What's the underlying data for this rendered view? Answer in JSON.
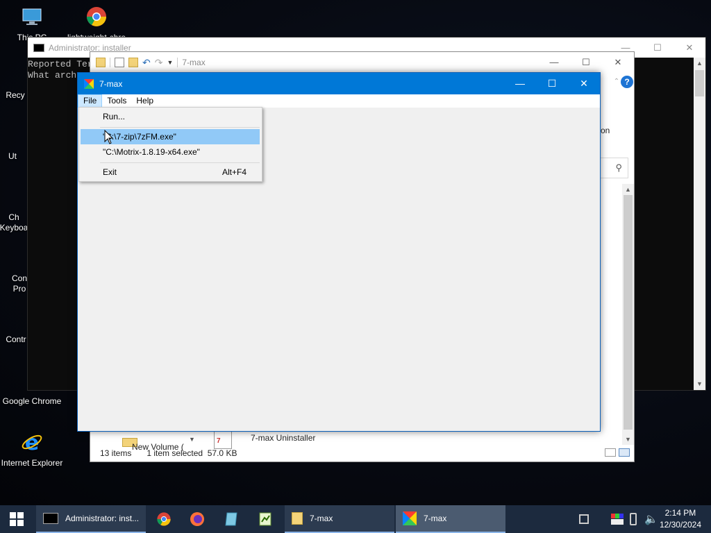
{
  "desktop": {
    "icons": [
      {
        "label": "This PC",
        "icon": "this-pc-icon"
      },
      {
        "label": "lightweight-chro",
        "icon": "chrome-icon"
      },
      {
        "label": "Recy",
        "icon": "recycle-bin-icon"
      },
      {
        "label": "Ut",
        "icon": "utility-icon"
      },
      {
        "label": "Ch Keyboa",
        "icon": "keyboard-icon"
      },
      {
        "label": "Con Pro",
        "icon": "command-prompt-icon"
      },
      {
        "label": "Contr",
        "icon": "control-panel-icon"
      },
      {
        "label": "Google Chrome",
        "icon": "chrome-icon"
      },
      {
        "label": "Internet Explorer",
        "icon": "ie-icon"
      }
    ]
  },
  "console": {
    "title": "Administrator: installer",
    "lines": [
      "Reported Ter",
      "What arch"
    ]
  },
  "explorer": {
    "title": "7-max",
    "side_text": "on",
    "items": [
      "7-max Uninstaller",
      "New Volume ("
    ],
    "status_items": "13 items",
    "status_selected": "1 item selected",
    "status_size": "57.0 KB"
  },
  "sevenmax": {
    "title": "7-max",
    "menu": [
      "File",
      "Tools",
      "Help"
    ],
    "dropdown": {
      "run": "Run...",
      "recent1": "\"C:\\7-zip\\7zFM.exe\"",
      "recent2": "\"C:\\Motrix-1.8.19-x64.exe\"",
      "exit": "Exit",
      "exit_accel": "Alt+F4"
    }
  },
  "taskbar": {
    "apps": [
      {
        "label": "Administrator: inst...",
        "icon": "console-icon"
      },
      {
        "label": "",
        "icon": "chrome-icon"
      },
      {
        "label": "",
        "icon": "firefox-icon"
      },
      {
        "label": "",
        "icon": "notepad-icon"
      },
      {
        "label": "",
        "icon": "spreadsheet-icon"
      },
      {
        "label": "7-max",
        "icon": "folder-icon"
      },
      {
        "label": "7-max",
        "icon": "7max-icon"
      }
    ],
    "time": "2:14 PM",
    "date": "12/30/2024"
  },
  "colors": {
    "titlebar_active": "#0078d7",
    "menu_highlight": "#91c9f7",
    "taskbar": "#1c2a3e"
  }
}
